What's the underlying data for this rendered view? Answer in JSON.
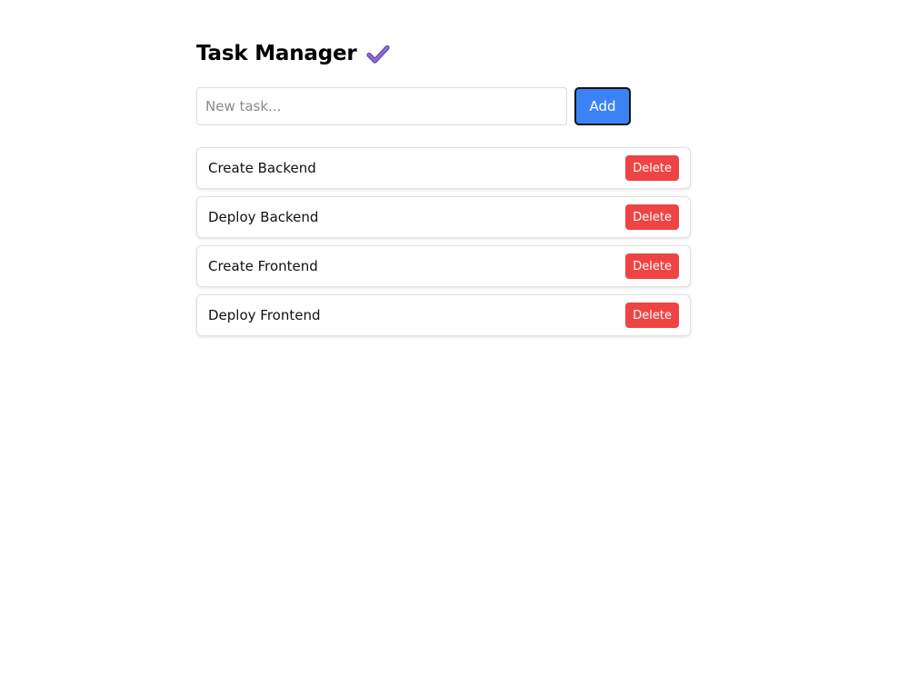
{
  "header": {
    "title": "Task Manager",
    "icon": "check-icon",
    "icon_color": "#7c5cc4"
  },
  "add_form": {
    "input_value": "",
    "input_placeholder": "New task...",
    "add_label": "Add",
    "add_color": "#3b82f6"
  },
  "tasks": [
    {
      "text": "Create Backend",
      "delete_label": "Delete"
    },
    {
      "text": "Deploy Backend",
      "delete_label": "Delete"
    },
    {
      "text": "Create Frontend",
      "delete_label": "Delete"
    },
    {
      "text": "Deploy Frontend",
      "delete_label": "Delete"
    }
  ],
  "colors": {
    "delete": "#ef4444"
  }
}
